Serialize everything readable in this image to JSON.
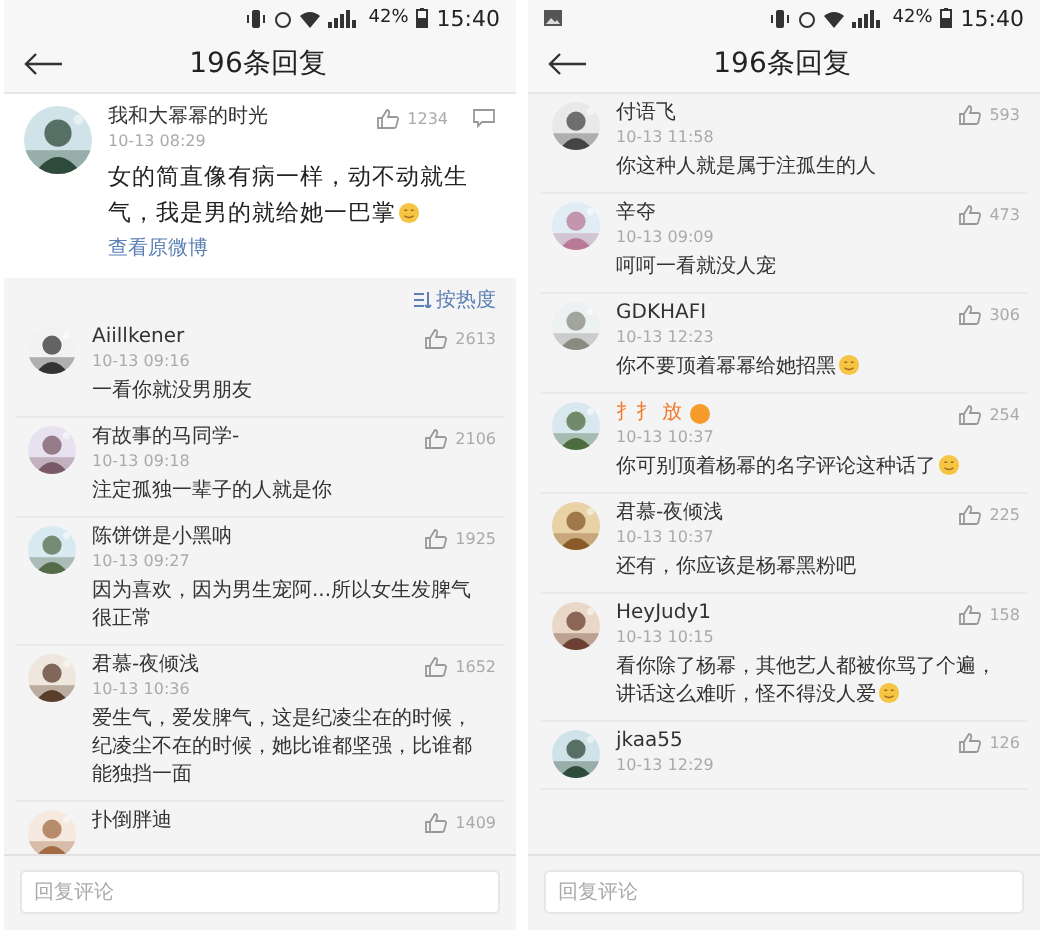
{
  "phones": [
    {
      "status": {
        "gallery_notification": false,
        "battery": "42%",
        "time": "15:40"
      },
      "header": {
        "title": "196条回复"
      },
      "post": {
        "name": "我和大幂幂的时光",
        "time": "10-13 08:29",
        "likes": "1234",
        "text": "女的简直像有病一样，动不动就生气，我是男的就给她一巴掌",
        "emoji": true,
        "link": "查看原微博"
      },
      "sort": {
        "label": "按热度"
      },
      "replies": [
        {
          "name": "Aiillkener",
          "time": "10-13 09:16",
          "likes": "2613",
          "text": "一看你就没男朋友",
          "emoji": false,
          "vip": false
        },
        {
          "name": "有故事的马同学-",
          "time": "10-13 09:18",
          "likes": "2106",
          "text": "注定孤独一辈子的人就是你",
          "emoji": false,
          "vip": false
        },
        {
          "name": "陈饼饼是小黑呐",
          "time": "10-13 09:27",
          "likes": "1925",
          "text": "因为喜欢，因为男生宠阿...所以女生发脾气很正常",
          "emoji": false,
          "vip": false
        },
        {
          "name": "君慕-夜倾浅",
          "time": "10-13 10:36",
          "likes": "1652",
          "text": "爱生气，爱发脾气，这是纪凌尘在的时候，纪凌尘不在的时候，她比谁都坚强，比谁都能独挡一面",
          "emoji": false,
          "vip": false
        },
        {
          "name": "扑倒胖迪",
          "likes": "1409",
          "vip": false
        }
      ],
      "footer": {
        "placeholder": "回复评论"
      }
    },
    {
      "status": {
        "gallery_notification": true,
        "battery": "42%",
        "time": "15:40"
      },
      "header": {
        "title": "196条回复"
      },
      "replies": [
        {
          "name": "付语飞",
          "time": "10-13 11:58",
          "likes": "593",
          "text": "你这种人就是属于注孤生的人",
          "emoji": false,
          "vip": false
        },
        {
          "name": "辛夺",
          "time": "10-13 09:09",
          "likes": "473",
          "text": "呵呵一看就没人宠",
          "emoji": false,
          "vip": false
        },
        {
          "name": "GDKHAFI",
          "time": "10-13 12:23",
          "likes": "306",
          "text": "你不要顶着幂幂给她招黑",
          "emoji": true,
          "vip": false
        },
        {
          "name": "扌扌 放",
          "time": "10-13 10:37",
          "likes": "254",
          "text": "你可别顶着杨幂的名字评论这种话了",
          "emoji": true,
          "vip": true
        },
        {
          "name": "君慕-夜倾浅",
          "time": "10-13 10:37",
          "likes": "225",
          "text": "还有，你应该是杨幂黑粉吧",
          "emoji": false,
          "vip": false
        },
        {
          "name": "HeyJudy1",
          "time": "10-13 10:15",
          "likes": "158",
          "text": "看你除了杨幂，其他艺人都被你骂了个遍，讲话这么难听，怪不得没人爱",
          "emoji": true,
          "vip": false
        },
        {
          "name": "jkaa55",
          "time": "10-13 12:29",
          "likes": "126",
          "vip": false
        }
      ],
      "footer": {
        "placeholder": "回复评论"
      }
    }
  ]
}
